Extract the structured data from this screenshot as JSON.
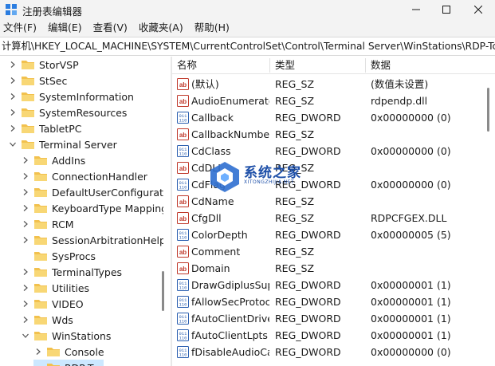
{
  "window": {
    "title": "注册表编辑器",
    "colors": {
      "titlebar": "#f3f3f3",
      "folder": "#f2c14e",
      "selection": "#cce8ff",
      "watermark": "#1d4fa8"
    }
  },
  "menu": {
    "items": [
      "文件(F)",
      "编辑(E)",
      "查看(V)",
      "收藏夹(A)",
      "帮助(H)"
    ]
  },
  "address": {
    "path": "计算机\\HKEY_LOCAL_MACHINE\\SYSTEM\\CurrentControlSet\\Control\\Terminal Server\\WinStations\\RDP-Tcp"
  },
  "tree": {
    "items": [
      {
        "label": "StorVSP",
        "level": 1,
        "expanded": false
      },
      {
        "label": "StSec",
        "level": 1,
        "expanded": false
      },
      {
        "label": "SystemInformation",
        "level": 1,
        "expanded": false
      },
      {
        "label": "SystemResources",
        "level": 1,
        "expanded": false
      },
      {
        "label": "TabletPC",
        "level": 1,
        "expanded": false
      },
      {
        "label": "Terminal Server",
        "level": 1,
        "expanded": true
      },
      {
        "label": "AddIns",
        "level": 2,
        "expanded": false
      },
      {
        "label": "ConnectionHandler",
        "level": 2,
        "expanded": false
      },
      {
        "label": "DefaultUserConfiguration",
        "level": 2,
        "expanded": false
      },
      {
        "label": "KeyboardType Mapping",
        "level": 2,
        "expanded": false
      },
      {
        "label": "RCM",
        "level": 2,
        "expanded": false
      },
      {
        "label": "SessionArbitrationHelper",
        "level": 2,
        "expanded": false
      },
      {
        "label": "SysProcs",
        "level": 2,
        "expanded": null
      },
      {
        "label": "TerminalTypes",
        "level": 2,
        "expanded": false
      },
      {
        "label": "Utilities",
        "level": 2,
        "expanded": false
      },
      {
        "label": "VIDEO",
        "level": 2,
        "expanded": false
      },
      {
        "label": "Wds",
        "level": 2,
        "expanded": false
      },
      {
        "label": "WinStations",
        "level": 2,
        "expanded": true
      },
      {
        "label": "Console",
        "level": 3,
        "expanded": false
      },
      {
        "label": "RDP-Tcp",
        "level": 3,
        "expanded": null
      }
    ]
  },
  "list": {
    "headers": {
      "name": "名称",
      "type": "类型",
      "data": "数据"
    },
    "rows": [
      {
        "icon": "string-value-icon",
        "name": "(默认)",
        "type": "REG_SZ",
        "data": "(数值未设置)"
      },
      {
        "icon": "string-value-icon",
        "name": "AudioEnumerator",
        "type": "REG_SZ",
        "data": "rdpendp.dll"
      },
      {
        "icon": "binary-value-icon",
        "name": "Callback",
        "type": "REG_DWORD",
        "data": "0x00000000 (0)"
      },
      {
        "icon": "string-value-icon",
        "name": "CallbackNumber",
        "type": "REG_SZ",
        "data": ""
      },
      {
        "icon": "binary-value-icon",
        "name": "CdClass",
        "type": "REG_DWORD",
        "data": "0x00000000 (0)"
      },
      {
        "icon": "string-value-icon",
        "name": "CdDLL",
        "type": "REG_SZ",
        "data": ""
      },
      {
        "icon": "binary-value-icon",
        "name": "CdFlag",
        "type": "REG_DWORD",
        "data": "0x00000000 (0)"
      },
      {
        "icon": "string-value-icon",
        "name": "CdName",
        "type": "REG_SZ",
        "data": ""
      },
      {
        "icon": "string-value-icon",
        "name": "CfgDll",
        "type": "REG_SZ",
        "data": "RDPCFGEX.DLL"
      },
      {
        "icon": "binary-value-icon",
        "name": "ColorDepth",
        "type": "REG_DWORD",
        "data": "0x00000005 (5)"
      },
      {
        "icon": "string-value-icon",
        "name": "Comment",
        "type": "REG_SZ",
        "data": ""
      },
      {
        "icon": "string-value-icon",
        "name": "Domain",
        "type": "REG_SZ",
        "data": ""
      },
      {
        "icon": "binary-value-icon",
        "name": "DrawGdiplusSupportLevel",
        "type": "REG_DWORD",
        "data": "0x00000001 (1)"
      },
      {
        "icon": "binary-value-icon",
        "name": "fAllowSecProtocolNegotiation",
        "type": "REG_DWORD",
        "data": "0x00000001 (1)"
      },
      {
        "icon": "binary-value-icon",
        "name": "fAutoClientDrives",
        "type": "REG_DWORD",
        "data": "0x00000001 (1)"
      },
      {
        "icon": "binary-value-icon",
        "name": "fAutoClientLpts",
        "type": "REG_DWORD",
        "data": "0x00000001 (1)"
      },
      {
        "icon": "binary-value-icon",
        "name": "fDisableAudioCapture",
        "type": "REG_DWORD",
        "data": "0x00000000 (0)"
      }
    ]
  },
  "watermark": {
    "title": "系统之家",
    "subtitle": "XITONGZHIJIA.NET"
  }
}
